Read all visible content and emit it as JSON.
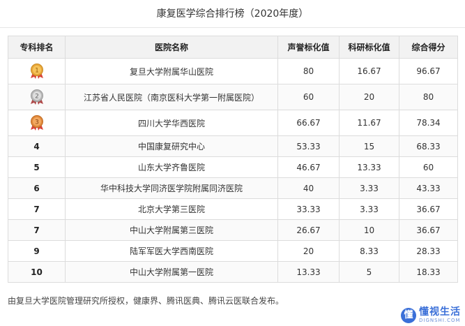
{
  "title": "康复医学综合排行榜（2020年度）",
  "colors": {
    "header_bg": "#f2f2f2",
    "border": "#dcdcdc",
    "gold": "#e8a73a",
    "silver": "#b8b8b8",
    "bronze": "#e08a3c",
    "logo_blue": "#3a6fd8"
  },
  "table": {
    "headers": [
      "专科排名",
      "医院名称",
      "声誉标化值",
      "科研标化值",
      "综合得分"
    ],
    "rows": [
      {
        "rank": "1",
        "medal": "gold-medal",
        "hospital": "复旦大学附属华山医院",
        "reputation": "80",
        "research": "16.67",
        "score": "96.67"
      },
      {
        "rank": "2",
        "medal": "silver-medal",
        "hospital": "江苏省人民医院（南京医科大学第一附属医院）",
        "reputation": "60",
        "research": "20",
        "score": "80"
      },
      {
        "rank": "3",
        "medal": "bronze-medal",
        "hospital": "四川大学华西医院",
        "reputation": "66.67",
        "research": "11.67",
        "score": "78.34"
      },
      {
        "rank": "4",
        "hospital": "中国康复研究中心",
        "reputation": "53.33",
        "research": "15",
        "score": "68.33"
      },
      {
        "rank": "5",
        "hospital": "山东大学齐鲁医院",
        "reputation": "46.67",
        "research": "13.33",
        "score": "60"
      },
      {
        "rank": "6",
        "hospital": "华中科技大学同济医学院附属同济医院",
        "reputation": "40",
        "research": "3.33",
        "score": "43.33"
      },
      {
        "rank": "7",
        "hospital": "北京大学第三医院",
        "reputation": "33.33",
        "research": "3.33",
        "score": "36.67"
      },
      {
        "rank": "7",
        "hospital": "中山大学附属第三医院",
        "reputation": "26.67",
        "research": "10",
        "score": "36.67"
      },
      {
        "rank": "9",
        "hospital": "陆军军医大学西南医院",
        "reputation": "20",
        "research": "8.33",
        "score": "28.33"
      },
      {
        "rank": "10",
        "hospital": "中山大学附属第一医院",
        "reputation": "13.33",
        "research": "5",
        "score": "18.33"
      }
    ]
  },
  "footer": "由复旦大学医院管理研究所授权，健康界、腾讯医典、腾讯云医联合发布。",
  "logo": {
    "mark": "懂",
    "cn": "懂视生活",
    "en": "DIGNSHI.COM"
  }
}
